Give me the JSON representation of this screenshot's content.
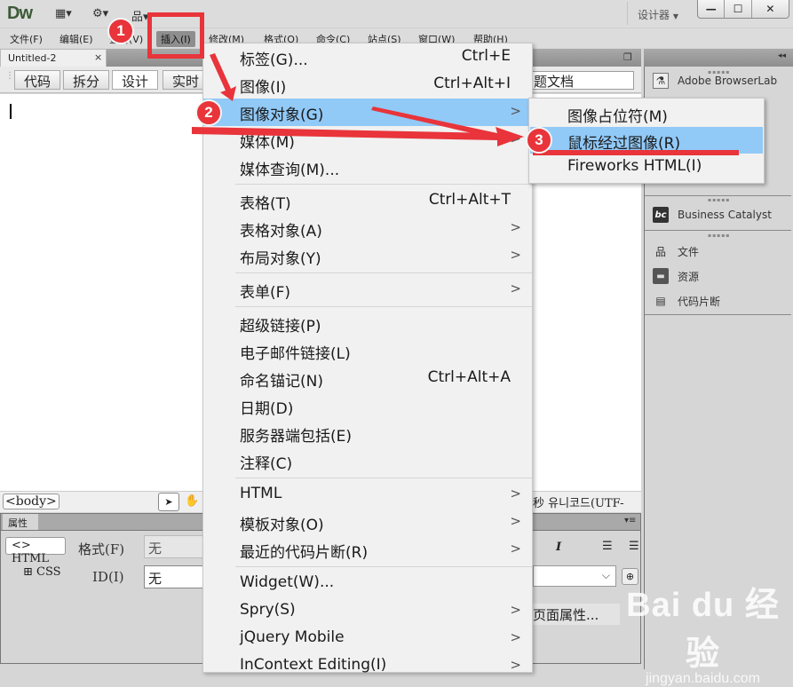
{
  "app": {
    "logo": "Dw",
    "toolbar_icons": [
      "layout-icon",
      "gear-icon",
      "site-icon"
    ],
    "workspace": "设计器",
    "window_buttons": {
      "minimize": "—",
      "maximize": "☐",
      "close": "✕"
    }
  },
  "menubar": [
    {
      "label": "文件(F)"
    },
    {
      "label": "编辑(E)"
    },
    {
      "label": "查看(V)"
    },
    {
      "label": "插入(I)",
      "active": true
    },
    {
      "label": "修改(M)"
    },
    {
      "label": "格式(O)"
    },
    {
      "label": "命令(C)"
    },
    {
      "label": "站点(S)"
    },
    {
      "label": "窗口(W)"
    },
    {
      "label": "帮助(H)"
    }
  ],
  "document": {
    "tab_title": "Untitled-2",
    "close_glyph": "×",
    "view_buttons": [
      "代码",
      "拆分",
      "设计",
      "实时"
    ],
    "title_field": "无标题文档",
    "title_visible": "题文档"
  },
  "statusbar": {
    "tag": "<body>",
    "encoding": "秒  유니코드(UTF-"
  },
  "properties": {
    "tab": "属性",
    "html_button": "<> HTML",
    "css_button": "CSS",
    "format_label": "格式(F)",
    "format_value": "无",
    "id_label": "ID(I)",
    "id_value": "无",
    "page_properties": "页面属性..."
  },
  "right_panel": {
    "items": [
      {
        "label": "Adobe BrowserLab",
        "icon": "browserlab-icon"
      },
      {
        "label": "Business Catalyst",
        "icon": "bc-icon"
      },
      {
        "label": "文件",
        "icon": "files-icon"
      },
      {
        "label": "资源",
        "icon": "assets-icon"
      },
      {
        "label": "代码片断",
        "icon": "snippets-icon"
      }
    ]
  },
  "insert_menu": {
    "items": [
      {
        "label": "标签(G)...",
        "shortcut": "Ctrl+E"
      },
      {
        "label": "图像(I)",
        "shortcut": "Ctrl+Alt+I"
      },
      {
        "label": "图像对象(G)",
        "submenu": true,
        "highlighted": true
      },
      {
        "label": "媒体(M)",
        "submenu": true
      },
      {
        "label": "媒体查询(M)..."
      },
      {
        "label": "表格(T)",
        "shortcut": "Ctrl+Alt+T"
      },
      {
        "label": "表格对象(A)",
        "submenu": true
      },
      {
        "label": "布局对象(Y)",
        "submenu": true
      },
      {
        "label": "表单(F)",
        "submenu": true
      },
      {
        "label": "超级链接(P)"
      },
      {
        "label": "电子邮件链接(L)"
      },
      {
        "label": "命名锚记(N)",
        "shortcut": "Ctrl+Alt+A"
      },
      {
        "label": "日期(D)"
      },
      {
        "label": "服务器端包括(E)"
      },
      {
        "label": "注释(C)"
      },
      {
        "label": "HTML",
        "submenu": true
      },
      {
        "label": "模板对象(O)",
        "submenu": true
      },
      {
        "label": "最近的代码片断(R)",
        "submenu": true
      },
      {
        "label": "Widget(W)..."
      },
      {
        "label": "Spry(S)",
        "submenu": true
      },
      {
        "label": "jQuery Mobile",
        "submenu": true
      },
      {
        "label": "InContext Editing(I)",
        "submenu": true
      }
    ],
    "submenu_arrow": ">"
  },
  "image_objects_submenu": {
    "items": [
      {
        "label": "图像占位符(M)"
      },
      {
        "label": "鼠标经过图像(R)",
        "highlighted": true
      },
      {
        "label": "Fireworks HTML(I)"
      }
    ]
  },
  "annotations": {
    "steps": [
      "1",
      "2",
      "3"
    ],
    "color": "#e8343a"
  },
  "watermark": {
    "main": "Bai du 经验",
    "sub": "jingyan.baidu.com"
  },
  "colors": {
    "menu_highlight": "#91c9f7",
    "annotation_red": "#e8343a",
    "chrome_gray": "#d6d6d6"
  }
}
